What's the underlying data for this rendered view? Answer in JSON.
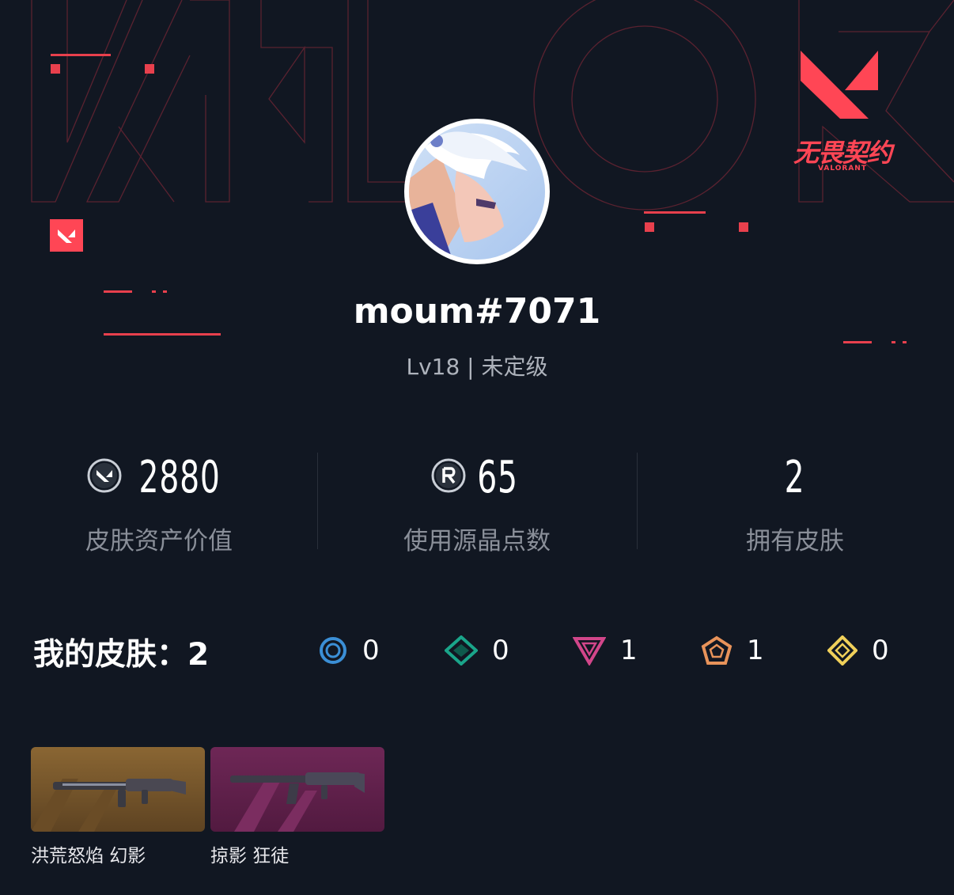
{
  "header": {
    "app_logo_cn": "无畏契约",
    "app_logo_en": "VALORANT"
  },
  "profile": {
    "username": "moum#7071",
    "level_text": "Lv18 | 未定级"
  },
  "stats": [
    {
      "value": "2880",
      "label": "皮肤资产价值",
      "icon": "valorant-points-icon"
    },
    {
      "value": "65",
      "label": "使用源晶点数",
      "icon": "radianite-icon"
    },
    {
      "value": "2",
      "label": "拥有皮肤",
      "icon": ""
    }
  ],
  "skins": {
    "title": "我的皮肤：2",
    "tiers": [
      {
        "icon": "select-tier-icon",
        "color": "#3b8fd6",
        "count": "0"
      },
      {
        "icon": "deluxe-tier-icon",
        "color": "#1aa58a",
        "count": "0"
      },
      {
        "icon": "premium-tier-icon",
        "color": "#d2468a",
        "count": "1"
      },
      {
        "icon": "exclusive-tier-icon",
        "color": "#e8935a",
        "count": "1"
      },
      {
        "icon": "ultra-tier-icon",
        "color": "#f0d05a",
        "count": "0"
      }
    ],
    "items": [
      {
        "name": "洪荒怒焰 幻影",
        "bg": "#7a5a30"
      },
      {
        "name": "掠影 狂徒",
        "bg": "#6a2550"
      }
    ]
  },
  "colors": {
    "accent": "#ff4655",
    "background": "#111722"
  }
}
